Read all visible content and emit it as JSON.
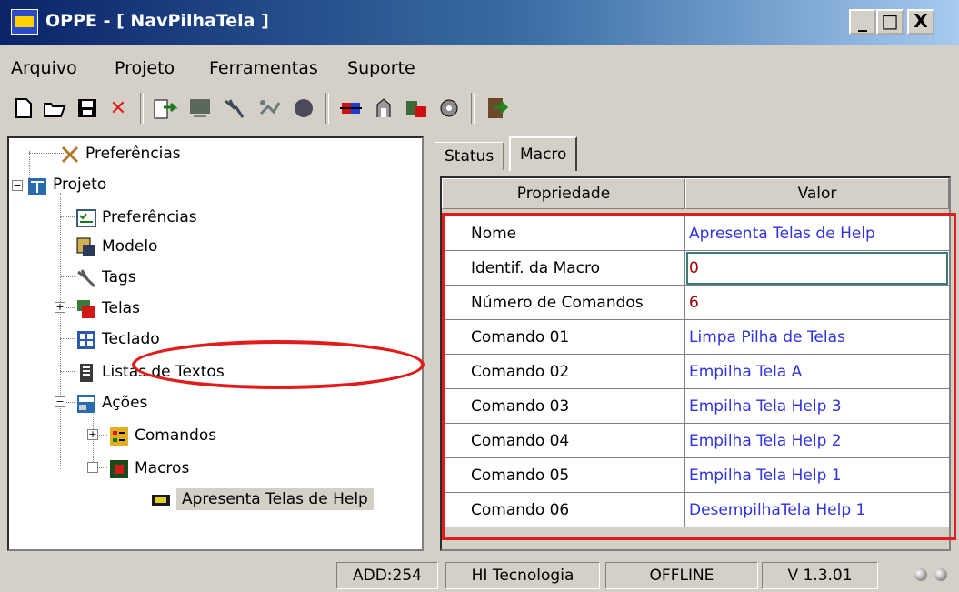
{
  "window": {
    "title": "OPPE - [ NavPilhaTela ]",
    "minimize": "_",
    "maximize": "□",
    "close": "X"
  },
  "menu": [
    {
      "mnemonic": "A",
      "rest": "rquivo"
    },
    {
      "mnemonic": "P",
      "rest": "rojeto"
    },
    {
      "mnemonic": "F",
      "rest": "erramentas"
    },
    {
      "mnemonic": "S",
      "rest": "uporte"
    }
  ],
  "toolbar": {
    "icons": [
      "new-file-icon",
      "open-folder-icon",
      "save-disk-icon",
      "delete-x-icon",
      "import-icon",
      "screen-icon",
      "tags-icon",
      "connect-icon",
      "record-icon",
      "transfer-icon",
      "device-icon",
      "compile-icon",
      "settings-icon",
      "exit-icon"
    ]
  },
  "tree": {
    "root_prefs": "Preferências",
    "project": "Projeto",
    "proj_prefs": "Preferências",
    "model": "Modelo",
    "tags": "Tags",
    "screens": "Telas",
    "keyboard": "Teclado",
    "text_lists": "Listas de Textos",
    "actions": "Ações",
    "commands": "Comandos",
    "macros": "Macros",
    "selected_macro": "Apresenta Telas de Help"
  },
  "tabs": {
    "status": "Status",
    "macro": "Macro"
  },
  "grid": {
    "header_prop": "Propriedade",
    "header_val": "Valor",
    "rows": [
      {
        "prop": "Nome",
        "val": "Apresenta Telas de Help"
      },
      {
        "prop": "Identif. da Macro",
        "val": "0"
      },
      {
        "prop": "Número de Comandos",
        "val": "6"
      },
      {
        "prop": "Comando 01",
        "val": "Limpa Pilha de Telas"
      },
      {
        "prop": "Comando 02",
        "val": "Empilha Tela A"
      },
      {
        "prop": "Comando 03",
        "val": "Empilha Tela Help 3"
      },
      {
        "prop": "Comando 04",
        "val": "Empilha Tela Help 2"
      },
      {
        "prop": "Comando 05",
        "val": "Empilha Tela Help 1"
      },
      {
        "prop": "Comando 06",
        "val": "DesempilhaTela Help 1"
      }
    ]
  },
  "status": {
    "address": "ADD:254",
    "company": "HI Tecnologia",
    "connection": "OFFLINE",
    "version": "V 1.3.01"
  },
  "colors": {
    "accent_red": "#e21b1b",
    "value_blue": "#2f33e0",
    "value_red": "#a00000",
    "title_blue": "#0a246a"
  }
}
